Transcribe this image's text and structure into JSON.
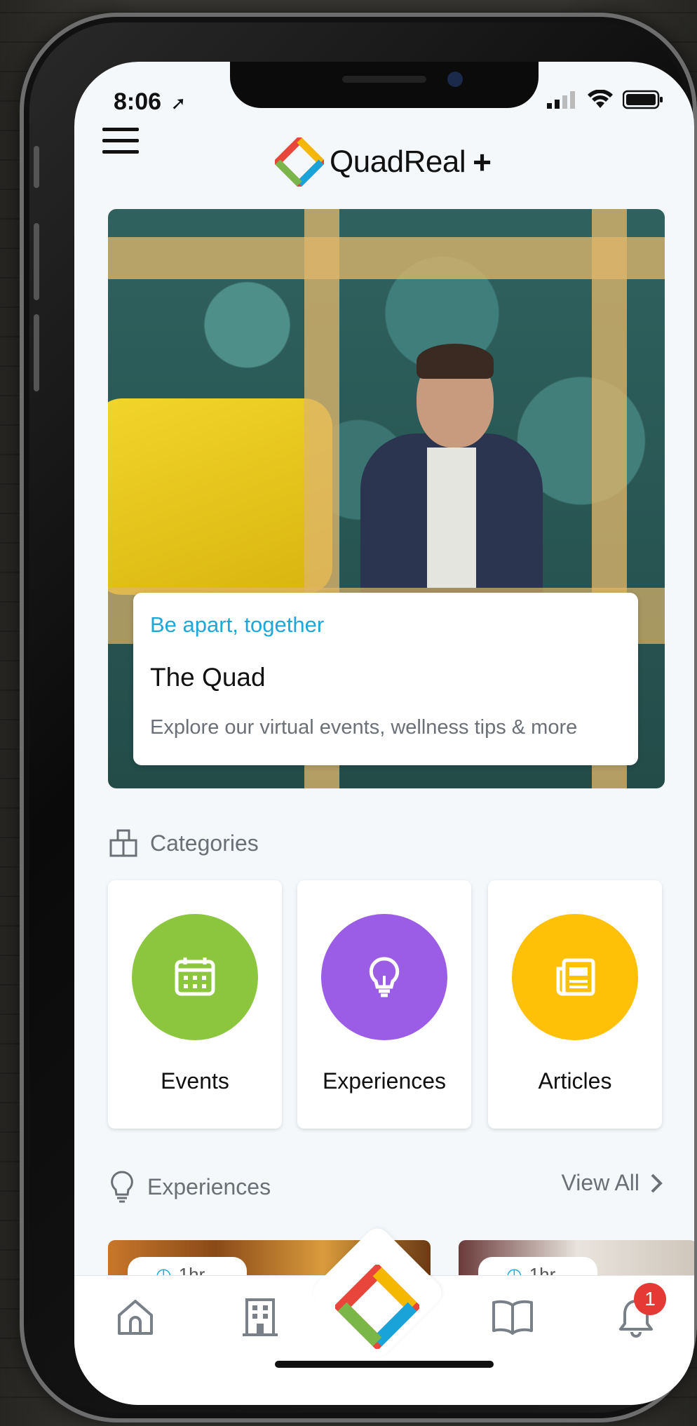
{
  "status_bar": {
    "time": "8:06",
    "icons": [
      "location-arrow-icon",
      "cellular-signal-icon",
      "wifi-icon",
      "battery-icon"
    ]
  },
  "header": {
    "menu_icon": "hamburger-menu-icon",
    "brand_name": "QuadReal",
    "brand_suffix": "+"
  },
  "hero": {
    "kicker": "Be apart, together",
    "title": "The Quad",
    "description": "Explore our virtual events, wellness tips & more",
    "kicker_color": "#1ea7d8"
  },
  "categories": {
    "heading": "Categories",
    "icon": "categories-icon",
    "items": [
      {
        "label": "Events",
        "icon": "calendar-icon",
        "color": "#8cc63f"
      },
      {
        "label": "Experiences",
        "icon": "lightbulb-icon",
        "color": "#9b5de5"
      },
      {
        "label": "Articles",
        "icon": "newspaper-icon",
        "color": "#ffc107"
      }
    ]
  },
  "experiences": {
    "heading": "Experiences",
    "icon": "lightbulb-outline-icon",
    "view_all": "View All",
    "cards": [
      {
        "duration": "1hr"
      },
      {
        "duration": "1hr"
      }
    ]
  },
  "tabbar": {
    "items": [
      "home-icon",
      "building-icon",
      "quadreal-logo-icon",
      "book-icon",
      "bell-icon"
    ],
    "notification_count": "1",
    "badge_color": "#e53935"
  }
}
